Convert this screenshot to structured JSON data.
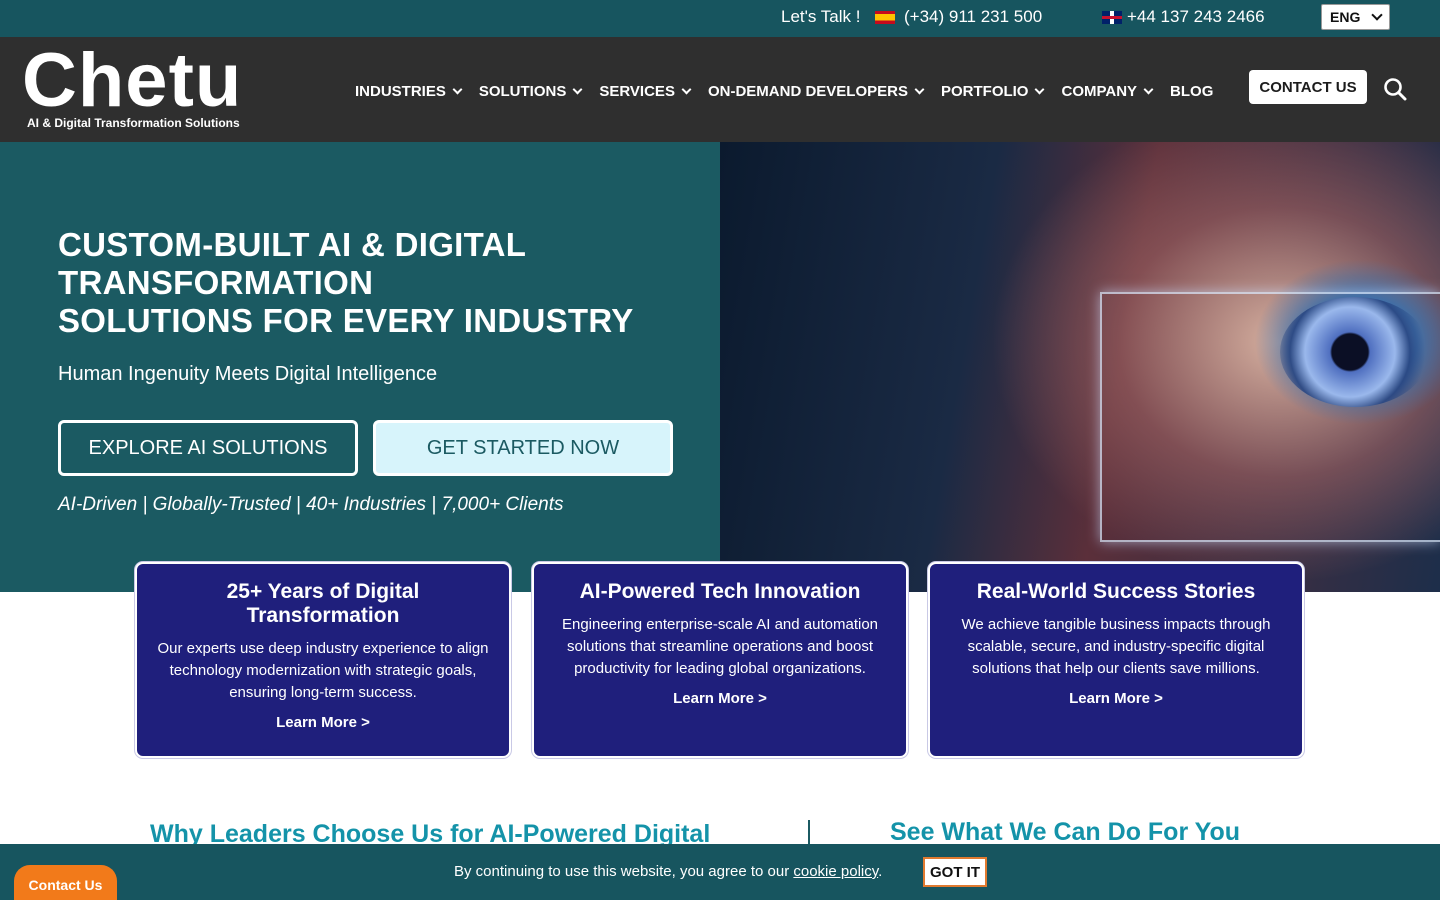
{
  "topbar": {
    "lets_talk": "Let's Talk !",
    "phone_es": "(+34) 911 231 500",
    "phone_uk": "+44 137 243 2466",
    "language": "ENG"
  },
  "header": {
    "logo_word": "Chetu",
    "logo_tagline": "AI & Digital Transformation Solutions",
    "nav": [
      "INDUSTRIES",
      "SOLUTIONS",
      "SERVICES",
      "ON-DEMAND DEVELOPERS",
      "PORTFOLIO",
      "COMPANY",
      "BLOG"
    ],
    "contact_label": "CONTACT US"
  },
  "hero": {
    "title_line1": "CUSTOM-BUILT AI & DIGITAL",
    "title_line2": "TRANSFORMATION",
    "title_line3": "SOLUTIONS FOR EVERY INDUSTRY",
    "subtitle": "Human Ingenuity Meets Digital Intelligence",
    "explore_label": "EXPLORE AI SOLUTIONS",
    "start_label": "GET STARTED NOW",
    "tagline": "AI-Driven | Globally-Trusted | 40+ Industries | 7,000+ Clients"
  },
  "cards": [
    {
      "title": "25+ Years of Digital Transformation",
      "text": "Our experts use deep industry experience to align technology modernization with strategic goals, ensuring long-term success.",
      "link": "Learn More >"
    },
    {
      "title": "AI-Powered Tech Innovation",
      "text": "Engineering enterprise-scale AI and automation solutions that streamline operations and boost productivity for leading global organizations.",
      "link": "Learn More >"
    },
    {
      "title": "Real-World Success Stories",
      "text": "We achieve tangible business impacts through scalable, secure, and industry-specific digital solutions that help our clients save millions.",
      "link": "Learn More >"
    }
  ],
  "sections": {
    "why_title": "Why Leaders Choose Us for AI-Powered Digital",
    "see_title": "See What We Can Do For You"
  },
  "cookie": {
    "text_before": "By continuing to use this website, you agree to our ",
    "link": "cookie policy",
    "text_after": ".",
    "button": "GOT IT"
  },
  "floating_contact": "Contact Us",
  "colors": {
    "teal": "#1b5a62",
    "topbar": "#17555f",
    "header": "#2f2f2f",
    "card_navy": "#1f1f7c",
    "heading_cyan": "#1493a9",
    "orange": "#f27a1a"
  }
}
